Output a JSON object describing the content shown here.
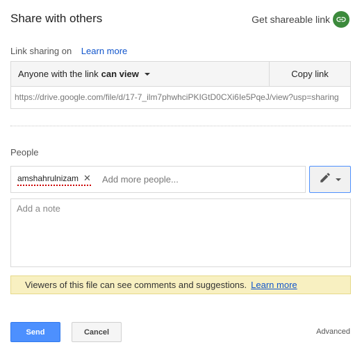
{
  "dialog": {
    "title": "Share with others",
    "shareable_link_label": "Get shareable link",
    "shareable_link_icon": "link-icon",
    "accent_color": "#3c8a3c"
  },
  "link_sharing": {
    "label": "Link sharing on",
    "learn_more": "Learn more",
    "access_prefix": "Anyone with the link",
    "access_level": "can view",
    "copy_link": "Copy link",
    "url": "https://drive.google.com/file/d/17-7_ilm7phwhciPKIGtD0CXi6Ie5PqeJ/view?usp=sharing"
  },
  "people": {
    "label": "People",
    "chips": [
      {
        "name": "amshahrulnizam"
      }
    ],
    "add_placeholder": "Add more people...",
    "permission_icon": "pencil-icon"
  },
  "note": {
    "placeholder": "Add a note"
  },
  "notice": {
    "text": "Viewers of this file can see comments and suggestions.",
    "link": "Learn more",
    "background": "#f8f0c1"
  },
  "footer": {
    "send": "Send",
    "cancel": "Cancel",
    "advanced": "Advanced",
    "send_color": "#4d90fe"
  }
}
